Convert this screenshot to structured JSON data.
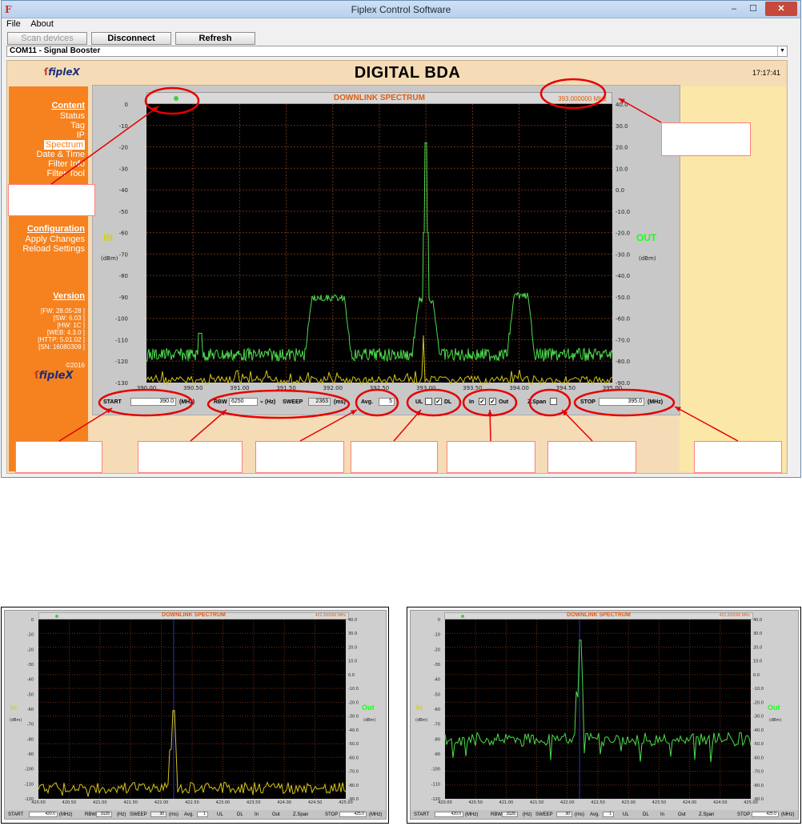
{
  "window": {
    "title": "Fiplex Control Software",
    "controls": {
      "minimize": "–",
      "maximize": "☐",
      "close": "✕"
    }
  },
  "menu": {
    "file": "File",
    "about": "About"
  },
  "toolbar": {
    "scan": "Scan devices",
    "disconnect": "Disconnect",
    "refresh": "Refresh"
  },
  "device_select": {
    "value": "COM11 - Signal Booster"
  },
  "header": {
    "logo": "fipleX",
    "title": "DIGITAL BDA",
    "clock": "17:17:41"
  },
  "sidebar": {
    "content_title": "Content",
    "content_items": [
      "Status",
      "Tag",
      "IP",
      "Spectrum",
      "Date & Time",
      "Filter Info",
      "Filter Tool"
    ],
    "active": "Spectrum",
    "config_title": "Configuration",
    "config_items": [
      "Apply Changes",
      "Reload Settings"
    ],
    "version_title": "Version",
    "version_lines": [
      "[FW: 28.05-28 ]",
      "[SW: 6.03 ]",
      "[HW: 1C ]",
      "[WEB: 4.3.0 ]",
      "[HTTP: 5.01.02 ]",
      "[SN: 16080309 ]"
    ],
    "copyright": "©2016",
    "logo": "fipleX"
  },
  "spectrum": {
    "title": "DOWNLINK SPECTRUM",
    "marker_freq": "393.000000 MHz",
    "in_label": "IN",
    "out_label": "OUT",
    "unit": "(dBm)",
    "left_ticks": [
      "0",
      "-10",
      "-20",
      "-30",
      "-40",
      "-50",
      "-60",
      "-70",
      "-80",
      "-90",
      "-100",
      "-110",
      "-120",
      "-130"
    ],
    "right_ticks": [
      "40.0",
      "30.0",
      "20.0",
      "10.0",
      "0.0",
      "-10.0",
      "-20.0",
      "-30.0",
      "-40.0",
      "-50.0",
      "-60.0",
      "-70.0",
      "-80.0",
      "-90.0"
    ],
    "x_ticks": [
      "390.00",
      "390.50",
      "391.00",
      "391.50",
      "392.00",
      "392.50",
      "393.00",
      "393.50",
      "394.00",
      "394.50",
      "395.00"
    ]
  },
  "controls": {
    "start_label": "START",
    "start_value": "390.0",
    "start_unit": "(MHz)",
    "rbw_label": "RBW",
    "rbw_value": "6250",
    "rbw_unit": "(Hz)",
    "sweep_label": "SWEEP",
    "sweep_value": "2363",
    "sweep_unit": "(ms)",
    "avg_label": "Avg.",
    "avg_value": "5",
    "ul_label": "UL",
    "ul_checked": false,
    "dl_label": "DL",
    "dl_checked": true,
    "in_label": "In",
    "in_checked": true,
    "out_label": "Out",
    "out_checked": true,
    "zspan_label": "Z.Span",
    "zspan_checked": false,
    "stop_label": "STOP",
    "stop_value": "395.0",
    "stop_unit": "(MHz)"
  },
  "colors": {
    "accent_orange": "#f5821f",
    "header_bg": "#f5dcb6",
    "right_panel": "#fbe7a7",
    "trace_out": "#4ddc4d",
    "trace_in": "#d4c51a",
    "annotation": "#e60000"
  },
  "small_spectrum_left": {
    "title": "DOWNLINK SPECTRUM",
    "marker_freq": "422.200000 MHz",
    "in_label": "In",
    "out_label": "Out",
    "unit": "(dBm)",
    "left_ticks": [
      "0",
      "-10",
      "-20",
      "-30",
      "-40",
      "-50",
      "-60",
      "-70",
      "-80",
      "-90",
      "-100",
      "-110",
      "-120"
    ],
    "right_ticks": [
      "40.0",
      "30.0",
      "20.0",
      "10.0",
      "0.0",
      "-10.0",
      "-20.0",
      "-30.0",
      "-40.0",
      "-50.0",
      "-60.0",
      "-70.0",
      "-80.0",
      "-90.0"
    ],
    "x_ticks": [
      "420.00",
      "420.50",
      "421.00",
      "421.50",
      "422.00",
      "422.50",
      "423.00",
      "423.50",
      "424.00",
      "424.50",
      "425.00"
    ],
    "start_label": "START",
    "start_value": "420.0",
    "start_unit": "(MHz)",
    "rbw_label": "RBW",
    "rbw_value": "3125",
    "rbw_unit": "(Hz)",
    "sweep_label": "SWEEP",
    "sweep_value": "30",
    "sweep_unit": "(ms)",
    "avg_label": "Avg.",
    "avg_value": "1",
    "ul_label": "UL",
    "dl_label": "DL",
    "zspan_label": "Z.Span",
    "stop_label": "STOP",
    "stop_value": "425.0",
    "stop_unit": "(MHz)"
  },
  "small_spectrum_right": {
    "title": "DOWNLINK SPECTRUM",
    "marker_freq": "422.200000 MHz",
    "in_label": "In",
    "out_label": "Out",
    "unit": "(dBm)",
    "left_ticks": [
      "0",
      "-10",
      "-20",
      "-30",
      "-40",
      "-50",
      "-60",
      "-70",
      "-80",
      "-90",
      "-100",
      "-110",
      "-120"
    ],
    "right_ticks": [
      "40.0",
      "30.0",
      "20.0",
      "10.0",
      "0.0",
      "-10.0",
      "-20.0",
      "-30.0",
      "-40.0",
      "-50.0",
      "-60.0",
      "-70.0",
      "-80.0",
      "-90.0"
    ],
    "x_ticks": [
      "420.00",
      "420.50",
      "421.00",
      "421.50",
      "422.00",
      "422.50",
      "423.00",
      "423.50",
      "424.00",
      "424.50",
      "425.00"
    ],
    "start_label": "START",
    "start_value": "420.0",
    "start_unit": "(MHz)",
    "rbw_label": "RBW",
    "rbw_value": "3125",
    "rbw_unit": "(Hz)",
    "sweep_label": "SWEEP",
    "sweep_value": "30",
    "sweep_unit": "(ms)",
    "avg_label": "Avg.",
    "avg_value": "1",
    "ul_label": "UL",
    "dl_label": "DL",
    "zspan_label": "Z.Span",
    "stop_label": "STOP",
    "stop_value": "425.0",
    "stop_unit": "(MHz)"
  }
}
